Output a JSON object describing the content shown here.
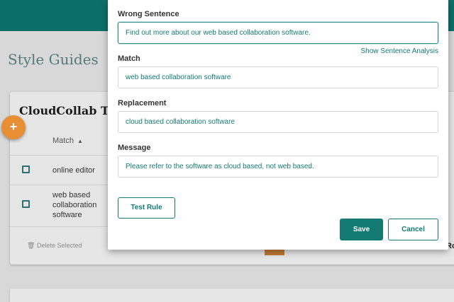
{
  "background": {
    "page_title": "Style Guides",
    "card_title": "CloudCollab Tea",
    "add_button_icon": "plus-icon",
    "table": {
      "header_match": "Match",
      "rows": [
        {
          "match": "online editor"
        },
        {
          "match": "web based collaboration software"
        }
      ]
    },
    "delete_selected_label": "Delete Selected",
    "right_edge_text": "Ro"
  },
  "modal": {
    "wrong_sentence": {
      "label": "Wrong Sentence",
      "value": "Find out more about our web based collaboration software."
    },
    "show_analysis_link": "Show Sentence Analysis",
    "match": {
      "label": "Match",
      "value": "web based collaboration software"
    },
    "replacement": {
      "label": "Replacement",
      "value": "cloud based collaboration software"
    },
    "message": {
      "label": "Message",
      "value": "Please refer to the software as cloud based, not web based."
    },
    "test_rule_label": "Test Rule",
    "save_label": "Save",
    "cancel_label": "Cancel"
  },
  "colors": {
    "primary": "#147a74",
    "header": "#0c6f67",
    "accent_orange": "#e88f35"
  }
}
